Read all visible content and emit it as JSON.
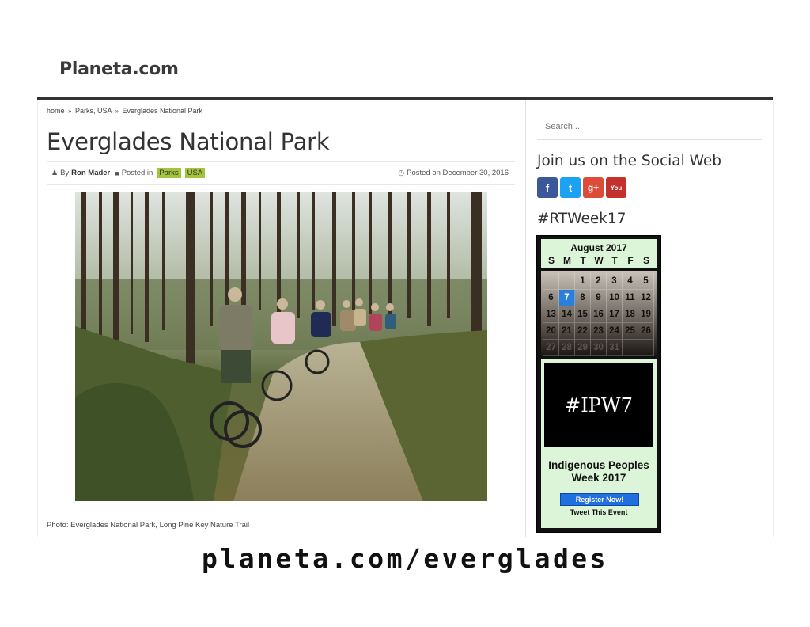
{
  "site": {
    "title": "Planeta.com"
  },
  "breadcrumb": {
    "home": "home",
    "sep": "»",
    "parent": "Parks, USA",
    "current": "Everglades National Park"
  },
  "post": {
    "title": "Everglades National Park",
    "by_label": "By",
    "author": "Ron Mader",
    "posted_in_label": "Posted in",
    "tags": [
      "Parks",
      "USA"
    ],
    "date": "Posted on December 30, 2016",
    "caption": "Photo: Everglades National Park, Long Pine Key Nature Trail"
  },
  "sidebar": {
    "search_placeholder": "Search ...",
    "social_title": "Join us on the Social Web",
    "social_icons": [
      {
        "name": "facebook-icon",
        "glyph": "f",
        "color": "#3b5998"
      },
      {
        "name": "twitter-icon",
        "glyph": "t",
        "color": "#1da1f2"
      },
      {
        "name": "google-plus-icon",
        "glyph": "g+",
        "color": "#dd4b39"
      },
      {
        "name": "youtube-icon",
        "glyph": "You",
        "color": "#c4302b"
      }
    ],
    "rtweek_title": "#RTWeek17",
    "calendar": {
      "month": "August 2017",
      "days_of_week": [
        "S",
        "M",
        "T",
        "W",
        "T",
        "F",
        "S"
      ],
      "today": "7",
      "weeks": [
        [
          "",
          "",
          "1",
          "2",
          "3",
          "4",
          "5"
        ],
        [
          "6",
          "7",
          "8",
          "9",
          "10",
          "11",
          "12"
        ],
        [
          "13",
          "14",
          "15",
          "16",
          "17",
          "18",
          "19"
        ],
        [
          "20",
          "21",
          "22",
          "23",
          "24",
          "25",
          "26"
        ],
        [
          "27",
          "28",
          "29",
          "30",
          "31",
          "",
          ""
        ]
      ]
    },
    "ipw": {
      "image_text": "#IPW7",
      "title_line1": "Indigenous Peoples",
      "title_line2": "Week 2017",
      "register": "Register Now!",
      "tweet": "Tweet This Event"
    }
  },
  "footer": {
    "url": "planeta.com/everglades"
  },
  "colors": {
    "tag_bg": "#a4c43c",
    "topbar": "#333333",
    "today_bg": "#2b7fd9",
    "register_bg": "#1f6fe0"
  }
}
